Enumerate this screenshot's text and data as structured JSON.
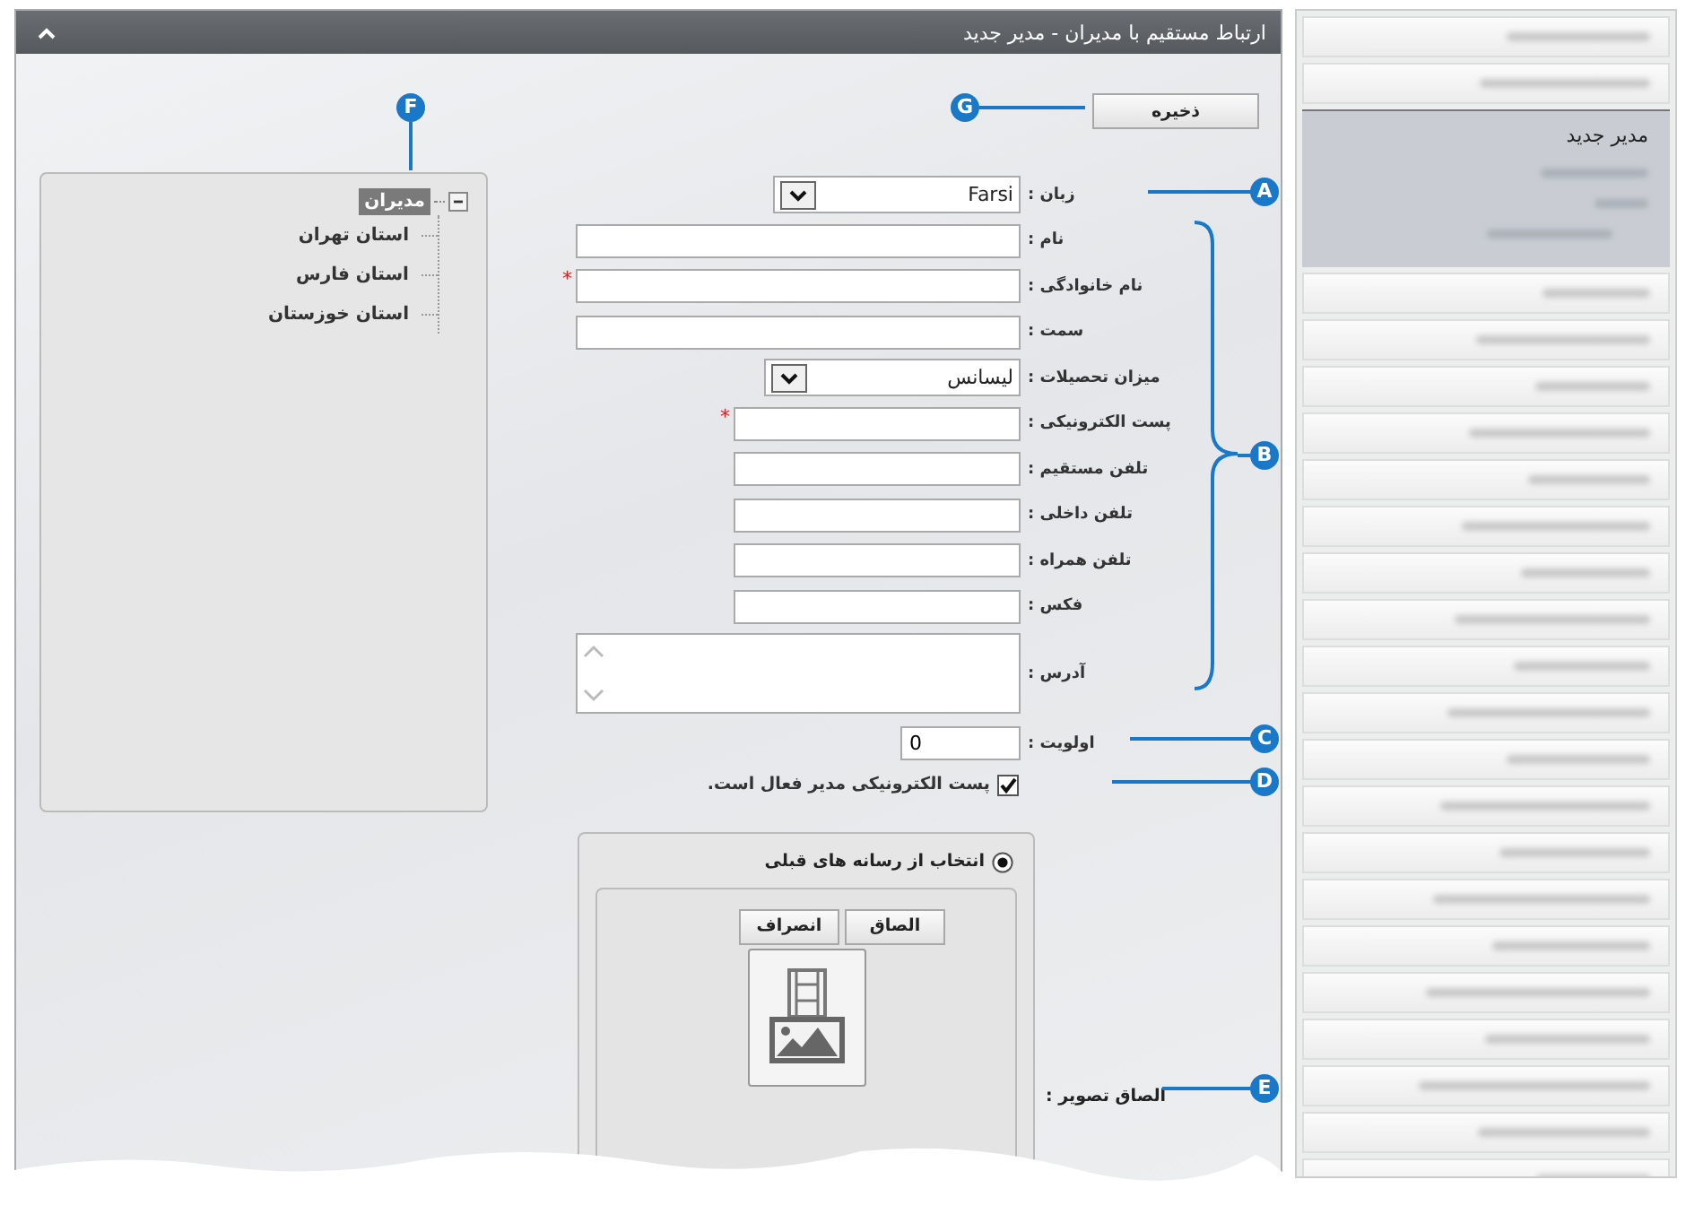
{
  "window": {
    "title": "ارتباط مستقیم با مدیران - مدیر جدید"
  },
  "save_button": "ذخیره",
  "tree": {
    "label": "مدیران",
    "expanded": true,
    "selected": true,
    "children": [
      {
        "label": "استان تهران",
        "selected": false
      },
      {
        "label": "استان فارس",
        "selected": false
      },
      {
        "label": "استان خوزستان",
        "selected": false
      }
    ]
  },
  "form": {
    "fields": [
      {
        "kind": "select",
        "label": "زبان :",
        "value": "Farsi"
      },
      {
        "kind": "text",
        "label": "نام :"
      },
      {
        "kind": "text",
        "label": "نام خانوادگی :",
        "required_mark": "*"
      },
      {
        "kind": "text",
        "label": "سمت :"
      },
      {
        "kind": "select",
        "label": "میزان تحصیلات :",
        "value": "لیسانس"
      },
      {
        "kind": "text",
        "label": "پست الکترونیکی :",
        "required_mark": "*"
      },
      {
        "kind": "text",
        "label": "تلفن مستقیم :"
      },
      {
        "kind": "text",
        "label": "تلفن داخلی :"
      },
      {
        "kind": "text",
        "label": "تلفن همراه :"
      },
      {
        "kind": "text",
        "label": "فکس :"
      },
      {
        "kind": "textarea",
        "label": "آدرس :"
      },
      {
        "kind": "text",
        "label": "اولویت :",
        "value": "0"
      }
    ],
    "checkbox": {
      "label": "پست الکترونیکی مدیر فعال است.",
      "checked": true
    }
  },
  "media": {
    "label": "الصاق تصویر :",
    "option": {
      "label": "انتخاب از رسانه های قبلی",
      "selected": true
    },
    "buttons": [
      "الصاق",
      "انصراف"
    ]
  },
  "sidebar": {
    "items": [
      {
        "label": "مدیر جدید",
        "selected": true
      }
    ]
  },
  "callouts": [
    {
      "label": "G"
    },
    {
      "label": "F"
    },
    {
      "label": "A"
    },
    {
      "label": "B"
    },
    {
      "label": "C"
    },
    {
      "label": "D"
    },
    {
      "label": "E"
    }
  ]
}
